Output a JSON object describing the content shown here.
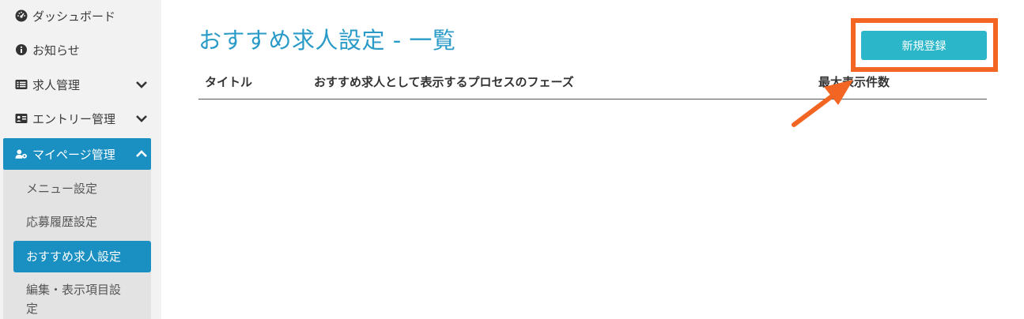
{
  "sidebar": {
    "items": [
      {
        "label": "ダッシュボード"
      },
      {
        "label": "お知らせ"
      },
      {
        "label": "求人管理"
      },
      {
        "label": "エントリー管理"
      },
      {
        "label": "マイページ管理"
      }
    ],
    "sub_items": [
      {
        "label": "メニュー設定"
      },
      {
        "label": "応募履歴設定"
      },
      {
        "label": "おすすめ求人設定"
      },
      {
        "label": "編集・表示項目設定"
      }
    ]
  },
  "main": {
    "title": "おすすめ求人設定 - 一覧",
    "new_button": "新規登録",
    "columns": [
      "タイトル",
      "おすすめ求人として表示するプロセスのフェーズ",
      "最大表示件数"
    ]
  },
  "colors": {
    "accent": "#1a8fc2",
    "button": "#2bb7c9",
    "annotation": "#f26522"
  }
}
